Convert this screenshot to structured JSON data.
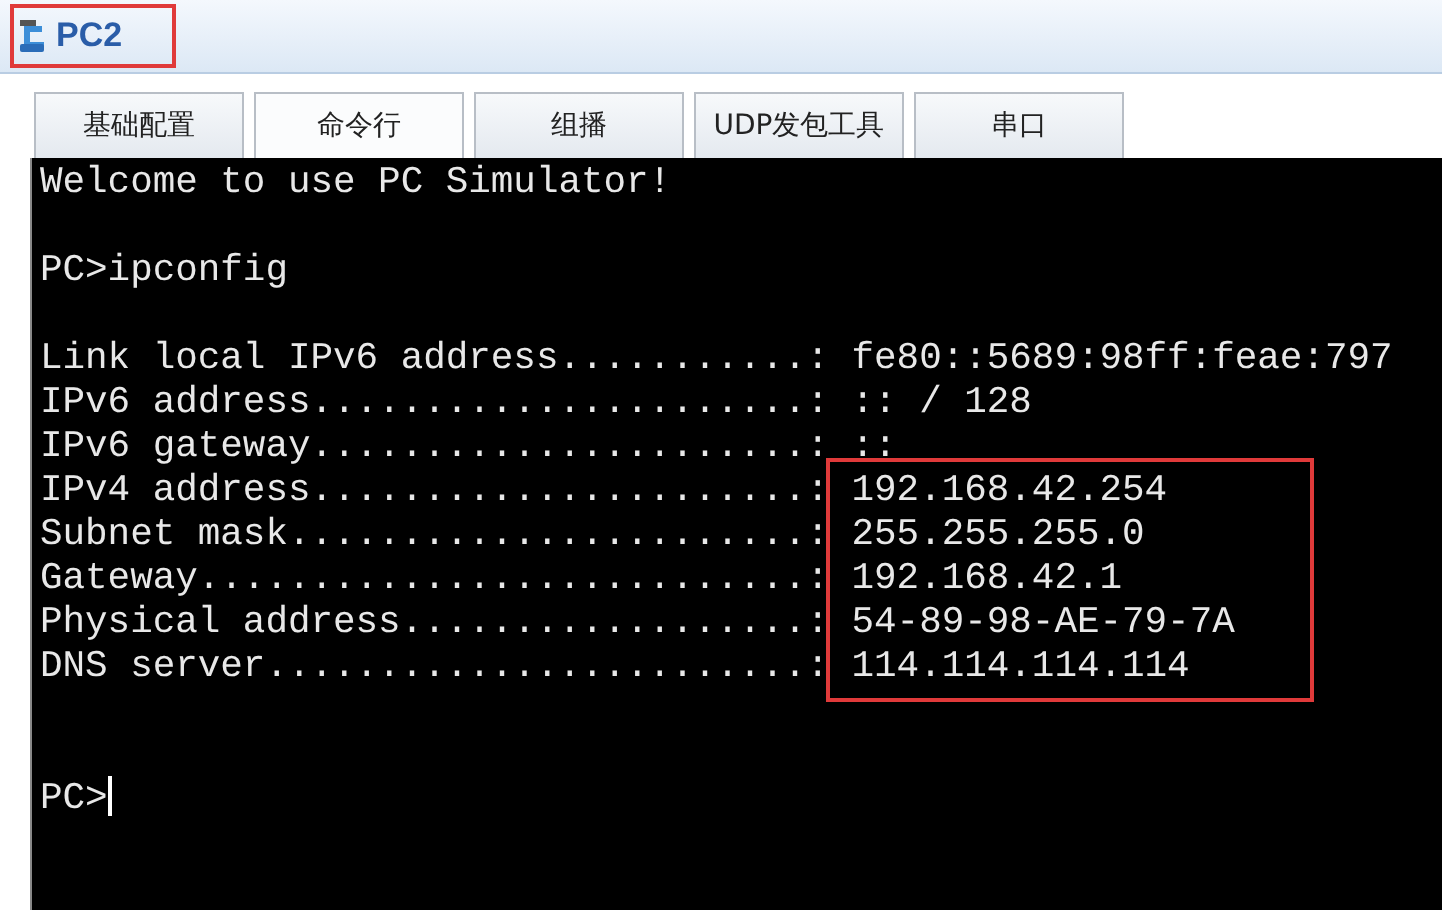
{
  "window": {
    "title": "PC2",
    "title_highlighted": true
  },
  "tabs": [
    {
      "label": "基础配置",
      "selected": false
    },
    {
      "label": "命令行",
      "selected": true
    },
    {
      "label": "组播",
      "selected": false
    },
    {
      "label": "UDP发包工具",
      "selected": false
    },
    {
      "label": "串口",
      "selected": false
    }
  ],
  "terminal": {
    "lines": [
      {
        "kind": "text",
        "text": "Welcome to use PC Simulator!"
      },
      {
        "kind": "blank"
      },
      {
        "kind": "text",
        "text": "PC>ipconfig"
      },
      {
        "kind": "blank"
      },
      {
        "kind": "field",
        "label": "Link local IPv6 address...........:",
        "value": "fe80::5689:98ff:feae:797",
        "highlighted": false
      },
      {
        "kind": "field",
        "label": "IPv6 address......................:",
        "value": ":: / 128",
        "highlighted": false
      },
      {
        "kind": "field",
        "label": "IPv6 gateway......................:",
        "value": "::",
        "highlighted": false
      },
      {
        "kind": "field",
        "label": "IPv4 address......................:",
        "value": "192.168.42.254",
        "highlighted": true
      },
      {
        "kind": "field",
        "label": "Subnet mask.......................:",
        "value": "255.255.255.0",
        "highlighted": true
      },
      {
        "kind": "field",
        "label": "Gateway...........................:",
        "value": "192.168.42.1",
        "highlighted": true
      },
      {
        "kind": "field",
        "label": "Physical address..................:",
        "value": "54-89-98-AE-79-7A",
        "highlighted": true
      },
      {
        "kind": "field",
        "label": "DNS server........................:",
        "value": "114.114.114.114",
        "highlighted": true
      },
      {
        "kind": "blank"
      },
      {
        "kind": "blank"
      },
      {
        "kind": "prompt",
        "text": "PC>",
        "cursor": true
      }
    ]
  }
}
